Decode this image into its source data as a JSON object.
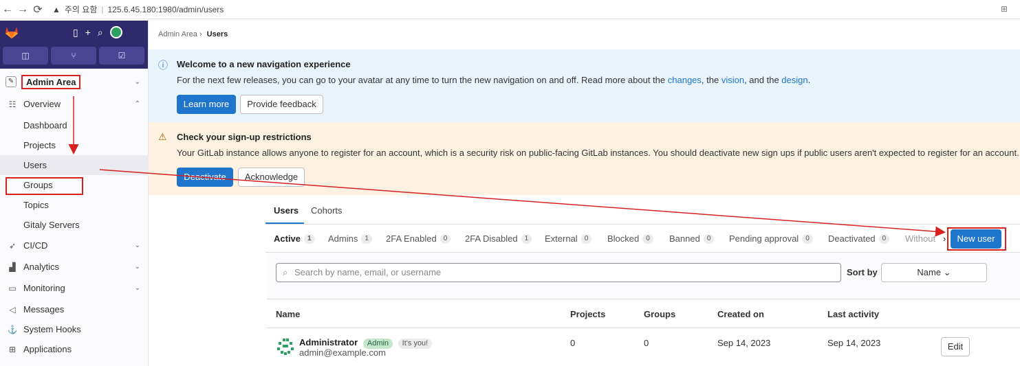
{
  "browser": {
    "back": "←",
    "forward": "→",
    "reload": "⟳",
    "warning_icon": "warning-icon",
    "security_label": "주의 요함",
    "url": "125.6.45.180:1980/admin/users",
    "translate_icon": "translate-icon"
  },
  "sidebar": {
    "context_label": "Admin Area",
    "items": [
      {
        "label": "Overview",
        "icon": "overview-icon"
      },
      {
        "label": "Dashboard"
      },
      {
        "label": "Projects"
      },
      {
        "label": "Users"
      },
      {
        "label": "Groups"
      },
      {
        "label": "Topics"
      },
      {
        "label": "Gitaly Servers"
      },
      {
        "label": "CI/CD",
        "icon": "rocket-icon"
      },
      {
        "label": "Analytics",
        "icon": "chart-icon"
      },
      {
        "label": "Monitoring",
        "icon": "monitor-icon"
      },
      {
        "label": "Messages",
        "icon": "megaphone-icon"
      },
      {
        "label": "System Hooks",
        "icon": "anchor-icon"
      },
      {
        "label": "Applications",
        "icon": "apps-icon"
      }
    ]
  },
  "breadcrumb": {
    "parent": "Admin Area",
    "separator": "›",
    "current": "Users"
  },
  "nav_alert": {
    "title": "Welcome to a new navigation experience",
    "text_before": "For the next few releases, you can go to your avatar at any time to turn the new navigation on and off. Read more about the ",
    "link1": "changes",
    "text_mid1": ", the ",
    "link2": "vision",
    "text_mid2": ", and the ",
    "link3": "design",
    "text_end": ".",
    "primary_button": "Learn more",
    "secondary_button": "Provide feedback"
  },
  "signup_alert": {
    "title": "Check your sign-up restrictions",
    "text": "Your GitLab instance allows anyone to register for an account, which is a security risk on public-facing GitLab instances. You should deactivate new sign ups if public users aren't expected to register for an account.",
    "primary_button": "Deactivate",
    "secondary_button": "Acknowledge"
  },
  "top_tabs": [
    "Users",
    "Cohorts"
  ],
  "filter_tabs": [
    {
      "label": "Active",
      "count": "1"
    },
    {
      "label": "Admins",
      "count": "1"
    },
    {
      "label": "2FA Enabled",
      "count": "0"
    },
    {
      "label": "2FA Disabled",
      "count": "1"
    },
    {
      "label": "External",
      "count": "0"
    },
    {
      "label": "Blocked",
      "count": "0"
    },
    {
      "label": "Banned",
      "count": "0"
    },
    {
      "label": "Pending approval",
      "count": "0"
    },
    {
      "label": "Deactivated",
      "count": "0"
    },
    {
      "label": "Without"
    }
  ],
  "scroll_right": "›",
  "new_user_button": "New user",
  "search": {
    "placeholder": "Search by name, email, or username"
  },
  "sort": {
    "label": "Sort by",
    "value": "Name ⌄"
  },
  "table": {
    "headers": [
      "Name",
      "Projects",
      "Groups",
      "Created on",
      "Last activity"
    ],
    "rows": [
      {
        "name": "Administrator",
        "badge_admin": "Admin",
        "badge_you": "It's you!",
        "email": "admin@example.com",
        "projects": "0",
        "groups": "0",
        "created": "Sep 14, 2023",
        "last_activity": "Sep 14, 2023",
        "action": "Edit"
      }
    ]
  },
  "colors": {
    "brand": "#2f2a6b",
    "primary": "#1f75cb",
    "annotation": "#d92020"
  }
}
